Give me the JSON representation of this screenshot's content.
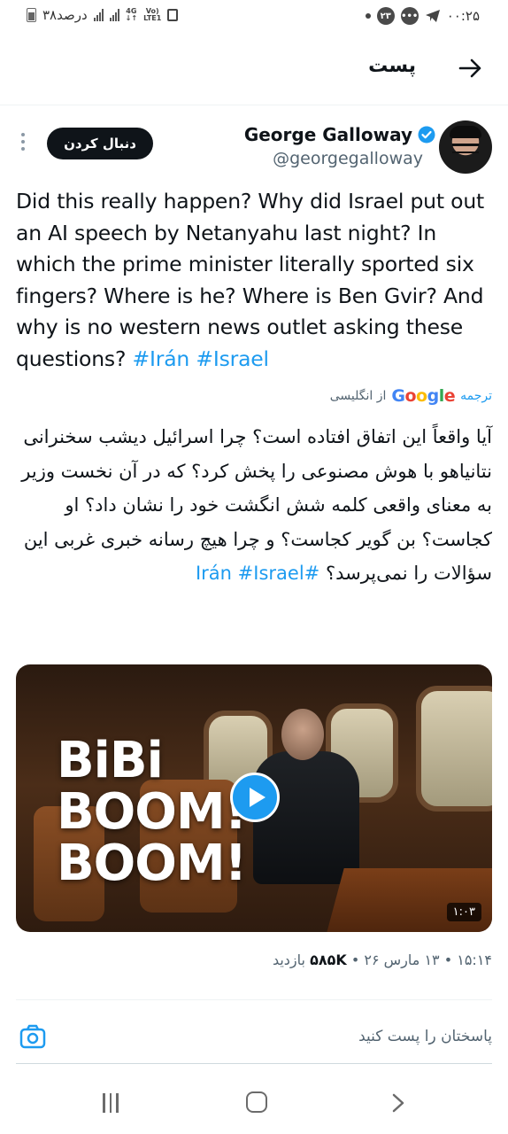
{
  "status_bar": {
    "battery_text": "۳۸درصد",
    "network_top": "4G",
    "network_vo": "Vo)",
    "network_lte": "LTE1",
    "time": "۰۰:۲۵",
    "notif_count": "۲۳"
  },
  "header": {
    "title": "پست"
  },
  "author": {
    "name": "George Galloway",
    "handle": "@georgegalloway",
    "follow_label": "دنبال کردن"
  },
  "tweet": {
    "text_main": "Did this really happen? Why did Israel put out an AI speech by Netanyahu last night? In which the prime minister literally sported six fingers? Where is he? Where is Ben Gvir? And why is no western news outlet asking these questions? ",
    "hashtag_1": "#Irán",
    "hashtag_2": "#Israel"
  },
  "translation": {
    "label": "ترجمه",
    "google": "Google",
    "from_lang": "از انگلیسی",
    "text": "آیا واقعاً این اتفاق افتاده است؟ چرا اسرائیل دیشب سخنرانی نتانیاهو با هوش مصنوعی را پخش کرد؟ که در آن نخست وزیر به معنای واقعی کلمه شش انگشت خود را نشان داد؟ او کجاست؟ بن گویر کجاست؟ و چرا هیچ رسانه خبری غربی این سؤالات را نمی‌پرسد؟ ",
    "hashtag_1": "#Irán",
    "hashtag_2": "#Israel"
  },
  "media": {
    "overlay_text_1": "BiBi",
    "overlay_text_2": "BOOM!",
    "overlay_text_3": "BOOM!",
    "duration": "۱:۰۳"
  },
  "meta": {
    "time_date": "۱۵:۱۴ • ۱۳ مارس ۲۶ • ",
    "views_count": "۵۸۵K",
    "views_label": " بازدید"
  },
  "reply": {
    "placeholder": "پاسختان را پست کنید"
  },
  "icons": {
    "back": "arrow-icon",
    "verified": "verified-badge-icon",
    "more": "kebab-icon",
    "camera": "camera-icon"
  },
  "colors": {
    "accent": "#1d9bf0",
    "text": "#0f1419",
    "muted": "#536471"
  }
}
